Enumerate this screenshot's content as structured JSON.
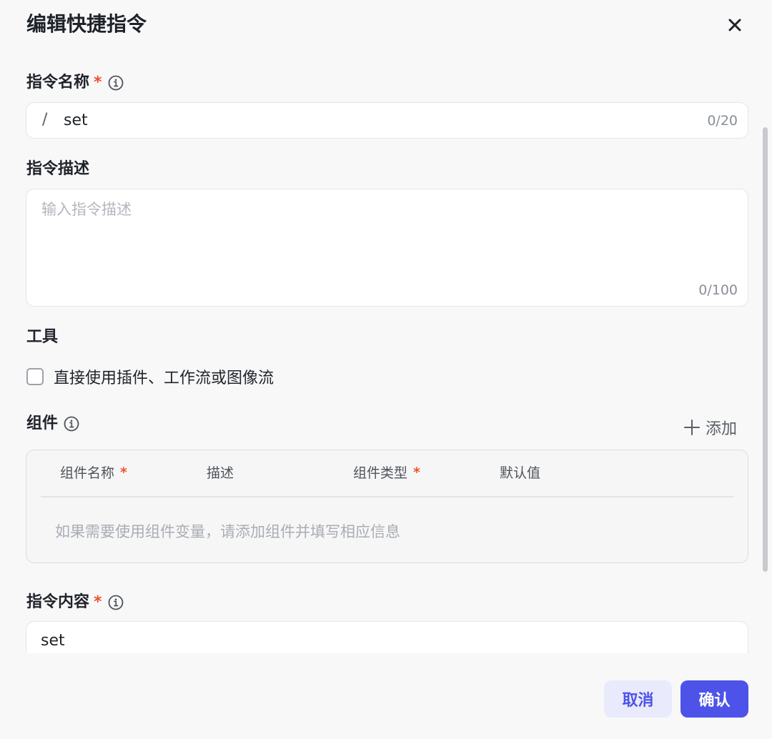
{
  "dialog": {
    "title": "编辑快捷指令"
  },
  "name_field": {
    "label": "指令名称",
    "required_mark": "*",
    "prefix": "/",
    "value": "set",
    "counter": "0/20"
  },
  "desc_field": {
    "label": "指令描述",
    "placeholder": "输入指令描述",
    "counter": "0/100"
  },
  "tools": {
    "label": "工具",
    "checkbox_label": "直接使用插件、工作流或图像流",
    "checked": false
  },
  "components": {
    "label": "组件",
    "add_label": "添加",
    "columns": [
      {
        "label": "组件名称",
        "required": true
      },
      {
        "label": "描述",
        "required": false
      },
      {
        "label": "组件类型",
        "required": true
      },
      {
        "label": "默认值",
        "required": false
      }
    ],
    "empty_text": "如果需要使用组件变量，请添加组件并填写相应信息"
  },
  "content_field": {
    "label": "指令内容",
    "required_mark": "*",
    "value": "set"
  },
  "footer": {
    "cancel_label": "取消",
    "confirm_label": "确认"
  },
  "colors": {
    "accent": "#4d53e8",
    "accent_light": "#e9eafb",
    "required": "#f0502f",
    "background": "#f8f8f9"
  }
}
